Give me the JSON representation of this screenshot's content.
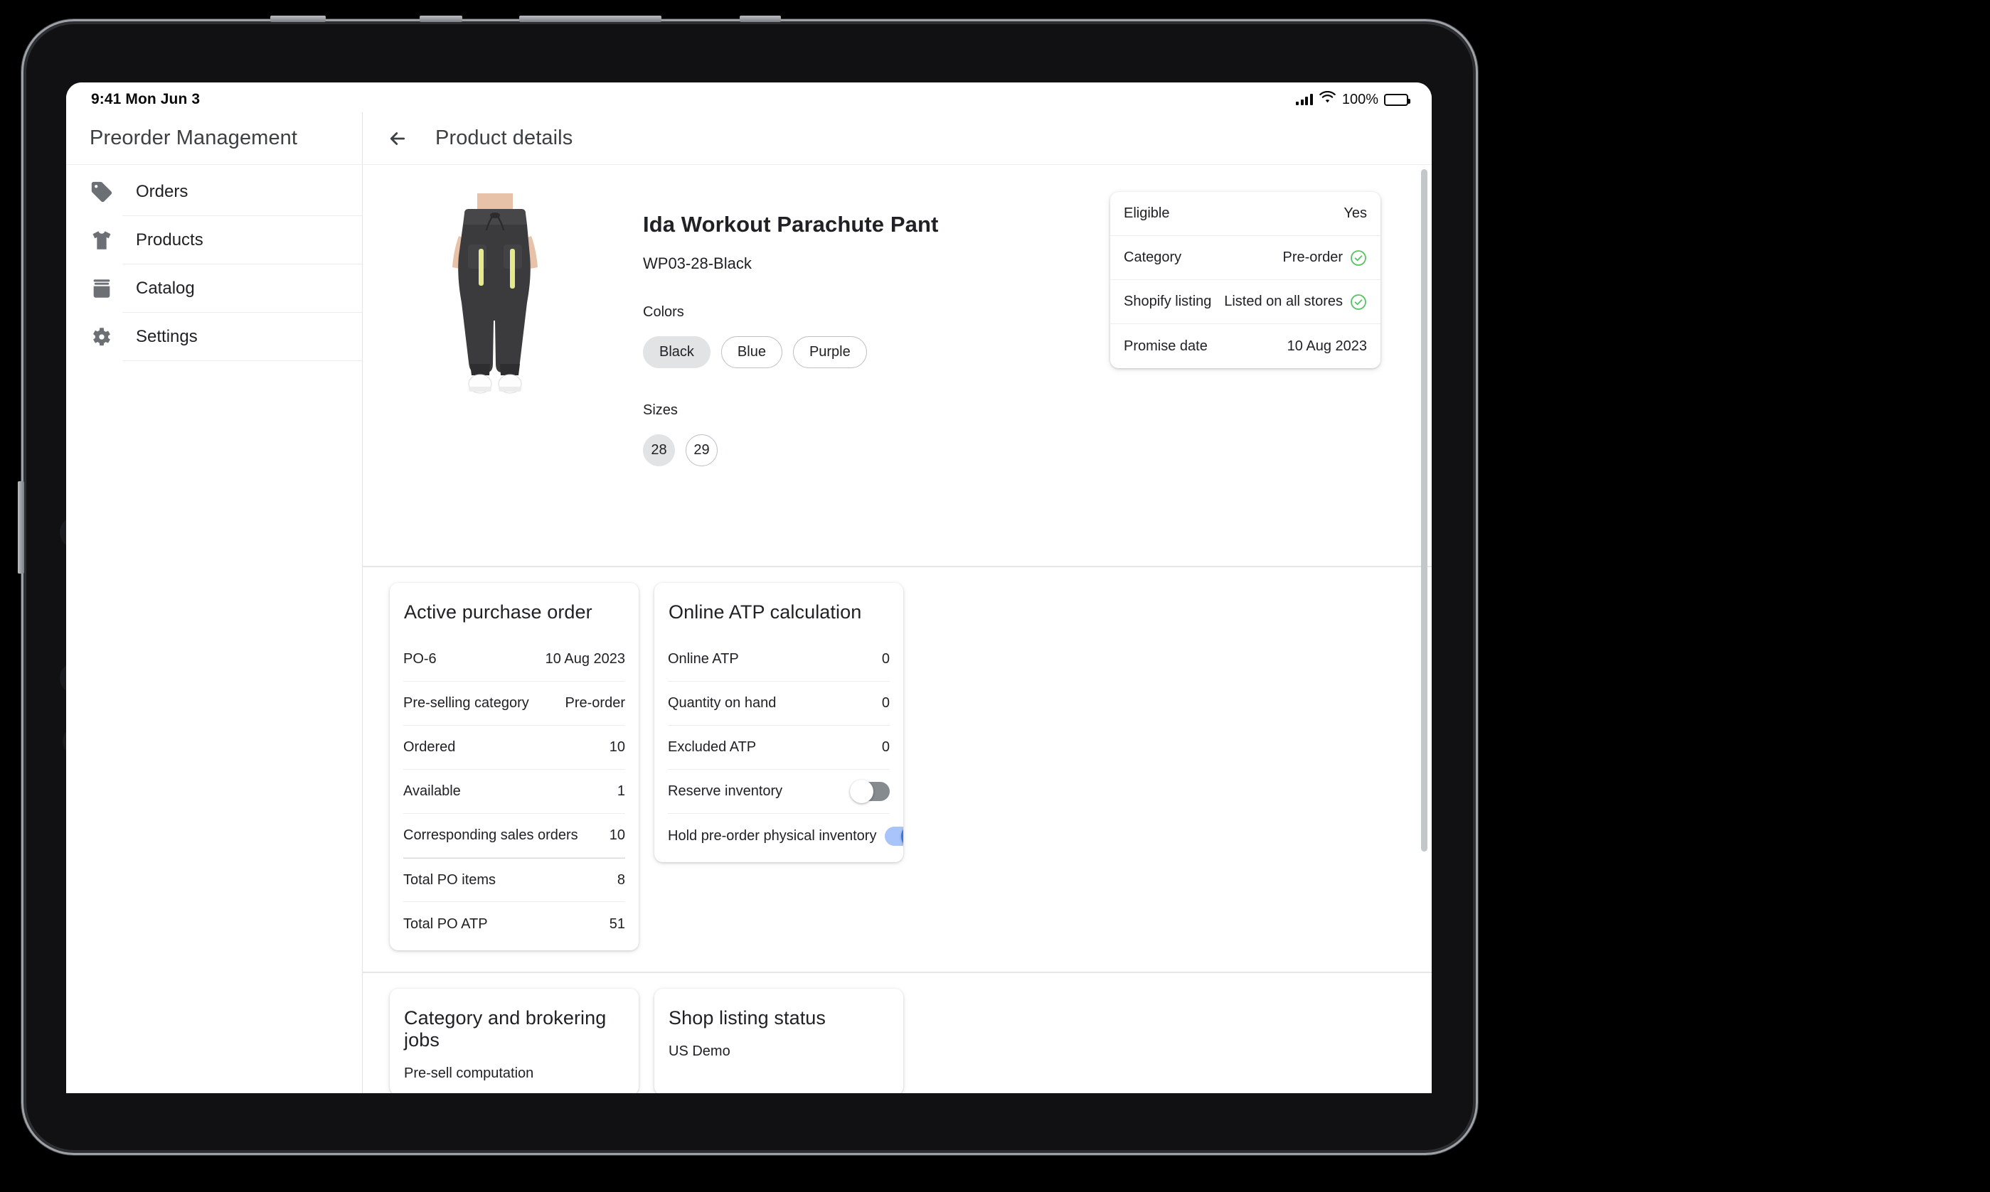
{
  "status_bar": {
    "time": "9:41",
    "date": "Mon Jun 3",
    "battery_percent": "100%",
    "signal_icon": "cellular-signal-icon",
    "wifi_icon": "wifi-icon",
    "battery_icon": "battery-full-icon"
  },
  "sidebar": {
    "app_title": "Preorder Management",
    "items": [
      {
        "label": "Orders",
        "icon": "tag-icon"
      },
      {
        "label": "Products",
        "icon": "tshirt-icon"
      },
      {
        "label": "Catalog",
        "icon": "box-icon"
      },
      {
        "label": "Settings",
        "icon": "gear-icon"
      }
    ]
  },
  "header": {
    "back_icon": "arrow-left-icon",
    "title": "Product details"
  },
  "product": {
    "image_alt": "workout-parachute-pant-photo",
    "name": "Ida Workout Parachute Pant",
    "sku": "WP03-28-Black",
    "colors_label": "Colors",
    "colors": [
      {
        "label": "Black",
        "selected": true
      },
      {
        "label": "Blue",
        "selected": false
      },
      {
        "label": "Purple",
        "selected": false
      }
    ],
    "sizes_label": "Sizes",
    "sizes": [
      {
        "label": "28",
        "selected": true
      },
      {
        "label": "29",
        "selected": false
      }
    ]
  },
  "eligibility_card": {
    "rows": [
      {
        "key": "Eligible",
        "value": "Yes",
        "check": false
      },
      {
        "key": "Category",
        "value": "Pre-order",
        "check": true
      },
      {
        "key": "Shopify listing",
        "value": "Listed on all stores",
        "check": true
      },
      {
        "key": "Promise date",
        "value": "10 Aug 2023",
        "check": false
      }
    ]
  },
  "active_purchase_order": {
    "title": "Active purchase order",
    "rows": [
      {
        "key": "PO-6",
        "value": "10 Aug 2023"
      },
      {
        "key": "Pre-selling category",
        "value": "Pre-order"
      },
      {
        "key": "Ordered",
        "value": "10"
      },
      {
        "key": "Available",
        "value": "1"
      },
      {
        "key": "Corresponding sales orders",
        "value": "10"
      },
      {
        "key": "Total PO items",
        "value": "8"
      },
      {
        "key": "Total PO ATP",
        "value": "51"
      }
    ]
  },
  "online_atp": {
    "title": "Online ATP calculation",
    "rows": [
      {
        "key": "Online ATP",
        "value": "0",
        "type": "value"
      },
      {
        "key": "Quantity on hand",
        "value": "0",
        "type": "value"
      },
      {
        "key": "Excluded ATP",
        "value": "0",
        "type": "value"
      }
    ],
    "toggles": [
      {
        "key": "Reserve inventory",
        "on": false
      },
      {
        "key": "Hold pre-order physical inventory",
        "on": true
      }
    ]
  },
  "bottom_cards": [
    {
      "title": "Category and brokering jobs",
      "sub": "Pre-sell computation"
    },
    {
      "title": "Shop listing status",
      "sub": "US Demo"
    }
  ],
  "colors": {
    "accent_blue": "#3b71ef",
    "accent_blue_track": "#a8c4fa",
    "toggle_off": "#868b90",
    "check_green": "#55c461",
    "chip_selected_bg": "#e2e3e5",
    "text_primary": "#202124",
    "text_secondary": "#3c4043"
  }
}
